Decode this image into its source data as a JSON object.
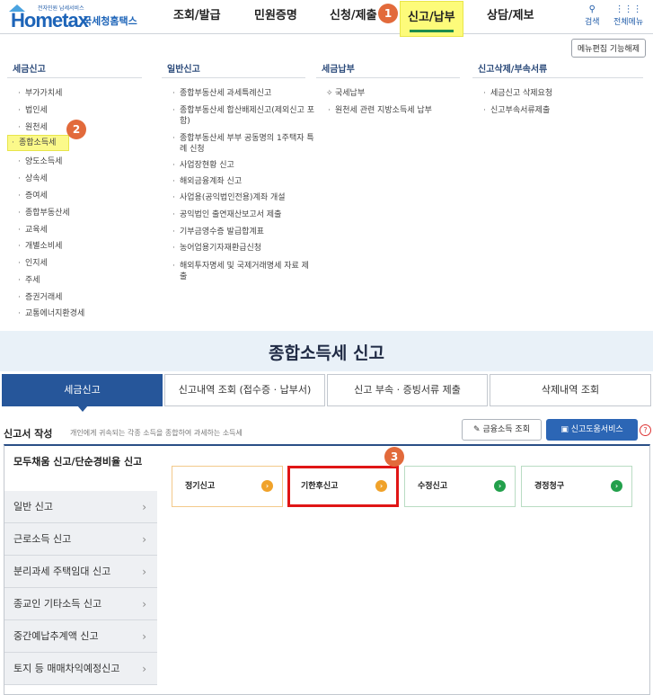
{
  "header": {
    "logo_small": "전자민원 납세서비스",
    "logo_main": "Hometax",
    "logo_kr": "국세청홈택스",
    "nav": [
      "조회/발급",
      "민원증명",
      "신청/제출",
      "신고/납부",
      "상담/제보"
    ],
    "search_label": "검색",
    "all_menu_label": "전체메뉴"
  },
  "badges": [
    "1",
    "2",
    "3"
  ],
  "menu_edit_label": "메뉴편집 기능해제",
  "columns": {
    "c1": {
      "title": "세금신고",
      "items": [
        "부가가치세",
        "법인세",
        "원천세",
        "종합소득세",
        "양도소득세",
        "상속세",
        "증여세",
        "종합부동산세",
        "교육세",
        "개별소비세",
        "인지세",
        "주세",
        "증권거래세",
        "교통에너지환경세"
      ]
    },
    "c2": {
      "title": "일반신고",
      "items": [
        "종합부동산세 과세특례신고",
        "종합부동산세 합산배제신고(제외신고 포함)",
        "종합부동산세 부부 공동명의 1주택자 특례 신청",
        "사업장현황 신고",
        "해외금융계좌 신고",
        "사업용(공익법인전용)계좌 개설",
        "공익법인 출연재산보고서 제출",
        "기부금영수증 발급합계표",
        "농어업용기자재환급신청",
        "해외투자명세 및 국제거래명세 자료 제출"
      ]
    },
    "c3": {
      "title": "세금납부",
      "items": [
        "국세납부",
        "원천세 관련 지방소득세 납부"
      ]
    },
    "c4": {
      "title": "신고삭제/부속서류",
      "items": [
        "세금신고 삭제요청",
        "신고부속서류제출"
      ]
    }
  },
  "hero_title": "종합소득세 신고",
  "tabs": [
    "세금신고",
    "신고내역 조회 (접수증 · 납부서)",
    "신고 부속 · 증빙서류 제출",
    "삭제내역 조회"
  ],
  "section": {
    "title": "신고서 작성",
    "desc": "개인에게 귀속되는 각종 소득을 종합하여 과세하는 소득세",
    "btn_finance": "금융소득 조회",
    "btn_help": "신고도움서비스",
    "help_icon": "?"
  },
  "side_menu": [
    "모두채움 신고/단순경비율 신고",
    "일반 신고",
    "근로소득 신고",
    "분리과세 주택임대 신고",
    "종교인 기타소득 신고",
    "중간예납추계액 신고",
    "토지 등 매매차익예정신고"
  ],
  "cards": [
    "정기신고",
    "기한후신고",
    "수정신고",
    "경정청구"
  ],
  "colors": {
    "brand": "#1d64b8",
    "active_tab": "#26569a",
    "highlight": "#fdfb7a",
    "red_box": "#e01515",
    "badge": "#e26a3b"
  }
}
